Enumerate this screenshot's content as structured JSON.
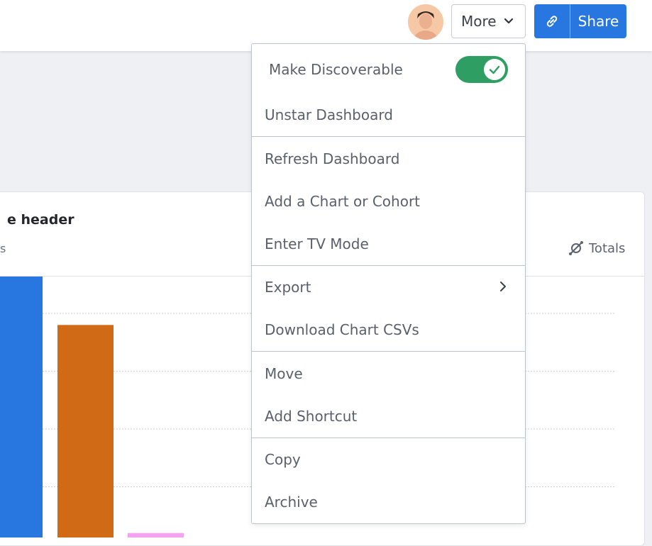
{
  "header": {
    "more_label": "More",
    "share_label": "Share",
    "colors": {
      "primary": "#2876e0",
      "toggle_on": "#2f9e63"
    }
  },
  "card": {
    "title": "e header",
    "subtitle": "s",
    "totals_label": "Totals"
  },
  "chart_data": {
    "type": "bar",
    "series": [
      {
        "values": [
          4.8
        ],
        "color": "#2876e0"
      },
      {
        "values": [
          3.8
        ],
        "color": "#d06a17"
      },
      {
        "values": [
          0.2
        ],
        "color": "#f3a3ef"
      }
    ],
    "ylim": [
      0,
      5.3
    ],
    "grid": true
  },
  "menu": {
    "make_discoverable": {
      "label": "Make Discoverable",
      "enabled": true
    },
    "items": [
      "Unstar Dashboard",
      "Refresh Dashboard",
      "Add a Chart or Cohort",
      "Enter TV Mode",
      "Export",
      "Download Chart CSVs",
      "Move",
      "Add Shortcut",
      "Copy",
      "Archive"
    ]
  },
  "icons": [
    "avatar",
    "chevron-down-icon",
    "link-icon",
    "check-icon",
    "chevron-right-icon",
    "totals-icon"
  ]
}
